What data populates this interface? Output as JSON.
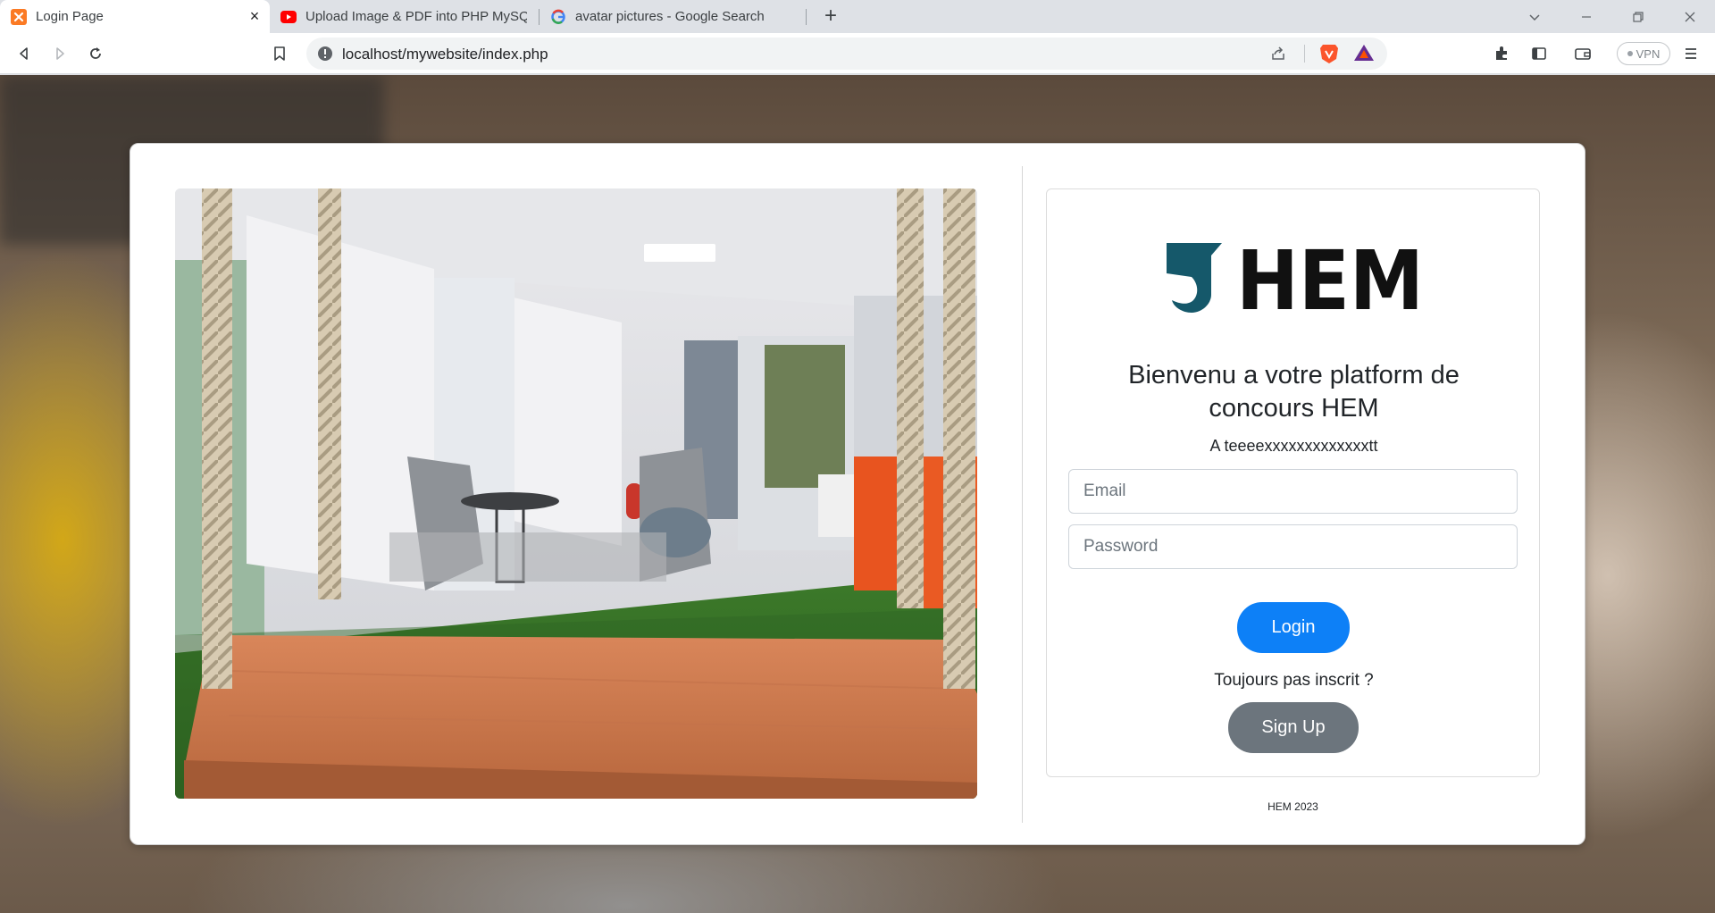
{
  "browser": {
    "tabs": [
      {
        "title": "Login Page",
        "icon": "xampp-icon",
        "active": true
      },
      {
        "title": "Upload Image & PDF into PHP MySQL",
        "icon": "youtube-icon",
        "active": false
      },
      {
        "title": "avatar pictures - Google Search",
        "icon": "google-icon",
        "active": false
      }
    ],
    "url": "localhost/mywebsite/index.php",
    "vpn_label": "VPN"
  },
  "login": {
    "logo_text": "HEM",
    "heading": "Bienvenu a votre platform de concours HEM",
    "subtitle": "A teeeexxxxxxxxxxxxxtt",
    "email_placeholder": "Email",
    "password_placeholder": "Password",
    "login_label": "Login",
    "not_registered": "Toujours pas inscrit ?",
    "signup_label": "Sign Up",
    "footer": "HEM 2023"
  },
  "colors": {
    "primary": "#0d80f7",
    "secondary": "#6c757d",
    "logo_teal": "#15586a"
  }
}
